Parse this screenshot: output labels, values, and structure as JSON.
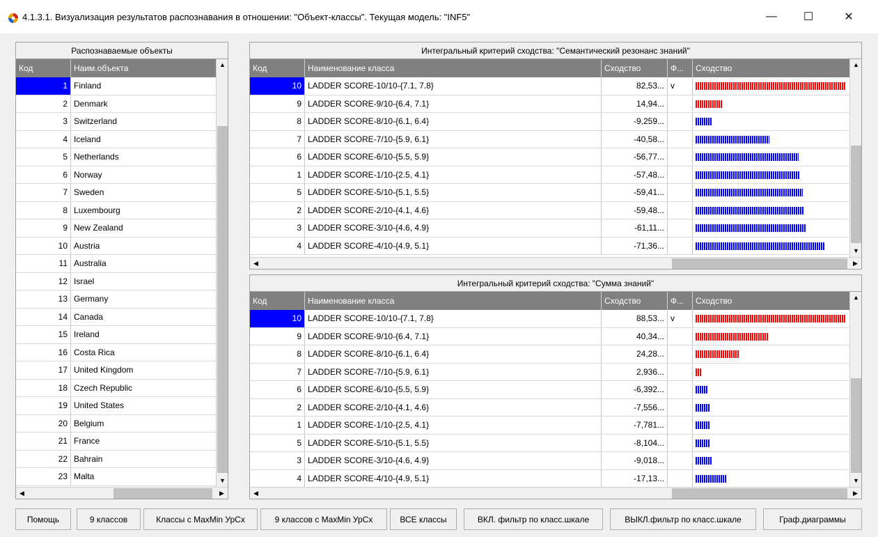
{
  "window": {
    "title": "4.1.3.1. Визуализация результатов распознавания в отношении: \"Объект-классы\". Текущая модель: \"INF5\"",
    "minimize": "—",
    "maximize": "☐",
    "close": "✕"
  },
  "objects_panel": {
    "caption": "Распознаваемые объекты",
    "col_code": "Код",
    "col_name": "Наим.объекта",
    "selected_code": 1,
    "rows": [
      {
        "code": "1",
        "name": "Finland"
      },
      {
        "code": "2",
        "name": "Denmark"
      },
      {
        "code": "3",
        "name": "Switzerland"
      },
      {
        "code": "4",
        "name": "Iceland"
      },
      {
        "code": "5",
        "name": "Netherlands"
      },
      {
        "code": "6",
        "name": "Norway"
      },
      {
        "code": "7",
        "name": "Sweden"
      },
      {
        "code": "8",
        "name": "Luxembourg"
      },
      {
        "code": "9",
        "name": "New Zealand"
      },
      {
        "code": "10",
        "name": "Austria"
      },
      {
        "code": "11",
        "name": "Australia"
      },
      {
        "code": "12",
        "name": "Israel"
      },
      {
        "code": "13",
        "name": "Germany"
      },
      {
        "code": "14",
        "name": "Canada"
      },
      {
        "code": "15",
        "name": "Ireland"
      },
      {
        "code": "16",
        "name": "Costa Rica"
      },
      {
        "code": "17",
        "name": "United Kingdom"
      },
      {
        "code": "18",
        "name": "Czech Republic"
      },
      {
        "code": "19",
        "name": "United States"
      },
      {
        "code": "20",
        "name": "Belgium"
      },
      {
        "code": "21",
        "name": "France"
      },
      {
        "code": "22",
        "name": "Bahrain"
      },
      {
        "code": "23",
        "name": "Malta"
      }
    ]
  },
  "semantic_panel": {
    "caption": "Интегральный критерий сходства: \"Семантический резонанс знаний\"",
    "col_code": "Код",
    "col_name": "Наименование класса",
    "col_sim": "Сходство",
    "col_f": "Ф...",
    "col_bar": "Сходство",
    "rows": [
      {
        "code": "10",
        "name": "LADDER SCORE-10/10-{7.1, 7.8}",
        "sim": "82,53...",
        "f": "v",
        "level": 0.8253,
        "color": "#ff0000"
      },
      {
        "code": "9",
        "name": "LADDER SCORE-9/10-{6.4, 7.1}",
        "sim": "14,94...",
        "f": "",
        "level": 0.1494,
        "color": "#ff0000"
      },
      {
        "code": "8",
        "name": "LADDER SCORE-8/10-{6.1, 6.4}",
        "sim": "-9,259...",
        "f": "",
        "level": 0.0926,
        "color": "#0000ff"
      },
      {
        "code": "7",
        "name": "LADDER SCORE-7/10-{5.9, 6.1}",
        "sim": "-40,58...",
        "f": "",
        "level": 0.4058,
        "color": "#0000ff"
      },
      {
        "code": "6",
        "name": "LADDER SCORE-6/10-{5.5, 5.9}",
        "sim": "-56,77...",
        "f": "",
        "level": 0.5677,
        "color": "#0000ff"
      },
      {
        "code": "1",
        "name": "LADDER SCORE-1/10-{2.5, 4.1}",
        "sim": "-57,48...",
        "f": "",
        "level": 0.5748,
        "color": "#0000ff"
      },
      {
        "code": "5",
        "name": "LADDER SCORE-5/10-{5.1, 5.5}",
        "sim": "-59,41...",
        "f": "",
        "level": 0.5941,
        "color": "#0000ff"
      },
      {
        "code": "2",
        "name": "LADDER SCORE-2/10-{4.1, 4.6}",
        "sim": "-59,48...",
        "f": "",
        "level": 0.5948,
        "color": "#0000ff"
      },
      {
        "code": "3",
        "name": "LADDER SCORE-3/10-{4.6, 4.9}",
        "sim": "-61,11...",
        "f": "",
        "level": 0.6111,
        "color": "#0000ff"
      },
      {
        "code": "4",
        "name": "LADDER SCORE-4/10-{4.9, 5.1}",
        "sim": "-71,36...",
        "f": "",
        "level": 0.7136,
        "color": "#0000ff"
      }
    ]
  },
  "sum_panel": {
    "caption": "Интегральный критерий сходства: \"Сумма знаний\"",
    "col_code": "Код",
    "col_name": "Наименование класса",
    "col_sim": "Сходство",
    "col_f": "Ф...",
    "col_bar": "Сходство",
    "rows": [
      {
        "code": "10",
        "name": "LADDER SCORE-10/10-{7.1, 7.8}",
        "sim": "88,53...",
        "f": "v",
        "level": 0.8853,
        "color": "#ff0000"
      },
      {
        "code": "9",
        "name": "LADDER SCORE-9/10-{6.4, 7.1}",
        "sim": "40,34...",
        "f": "",
        "level": 0.4034,
        "color": "#ff0000"
      },
      {
        "code": "8",
        "name": "LADDER SCORE-8/10-{6.1, 6.4}",
        "sim": "24,28...",
        "f": "",
        "level": 0.2428,
        "color": "#ff0000"
      },
      {
        "code": "7",
        "name": "LADDER SCORE-7/10-{5.9, 6.1}",
        "sim": "2,936...",
        "f": "",
        "level": 0.0294,
        "color": "#ff0000"
      },
      {
        "code": "6",
        "name": "LADDER SCORE-6/10-{5.5, 5.9}",
        "sim": "-6,392...",
        "f": "",
        "level": 0.0639,
        "color": "#0000ff"
      },
      {
        "code": "2",
        "name": "LADDER SCORE-2/10-{4.1, 4.6}",
        "sim": "-7,556...",
        "f": "",
        "level": 0.0756,
        "color": "#0000ff"
      },
      {
        "code": "1",
        "name": "LADDER SCORE-1/10-{2.5, 4.1}",
        "sim": "-7,781...",
        "f": "",
        "level": 0.0778,
        "color": "#0000ff"
      },
      {
        "code": "5",
        "name": "LADDER SCORE-5/10-{5.1, 5.5}",
        "sim": "-8,104...",
        "f": "",
        "level": 0.081,
        "color": "#0000ff"
      },
      {
        "code": "3",
        "name": "LADDER SCORE-3/10-{4.6, 4.9}",
        "sim": "-9,018...",
        "f": "",
        "level": 0.0902,
        "color": "#0000ff"
      },
      {
        "code": "4",
        "name": "LADDER SCORE-4/10-{4.9, 5.1}",
        "sim": "-17,13...",
        "f": "",
        "level": 0.1713,
        "color": "#0000ff"
      }
    ]
  },
  "buttons": {
    "help": "Помощь",
    "nine_classes": "9 классов",
    "maxmin_classes": "Классы с MaxMin УрСх",
    "nine_maxmin": "9 классов с MaxMin УрСх",
    "all_classes": "ВСЕ классы",
    "filter_on": "ВКЛ. фильтр по класс.шкале",
    "filter_off": "ВЫКЛ.фильтр по класс.шкале",
    "charts": "Граф.диаграммы"
  }
}
